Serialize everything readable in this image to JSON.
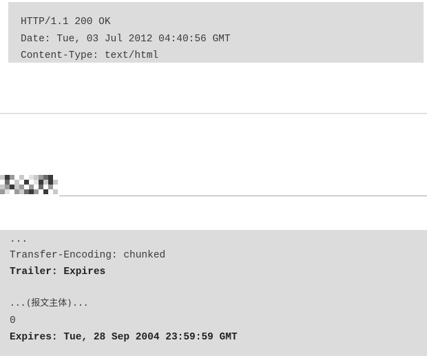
{
  "top_block": {
    "lines": [
      "HTTP/1.1 200 OK",
      "Date: Tue, 03 Jul 2012 04:40:56 GMT",
      "Content-Type: text/html"
    ]
  },
  "bottom_block": {
    "lines": [
      "...",
      "Transfer-Encoding: chunked",
      "Trailer: Expires",
      "...(报文主体)...",
      "0",
      "Expires: Tue, 28 Sep 2004 23:59:59 GMT"
    ]
  },
  "colors": {
    "code_background": "#dcdcdc",
    "text": "#333333"
  }
}
